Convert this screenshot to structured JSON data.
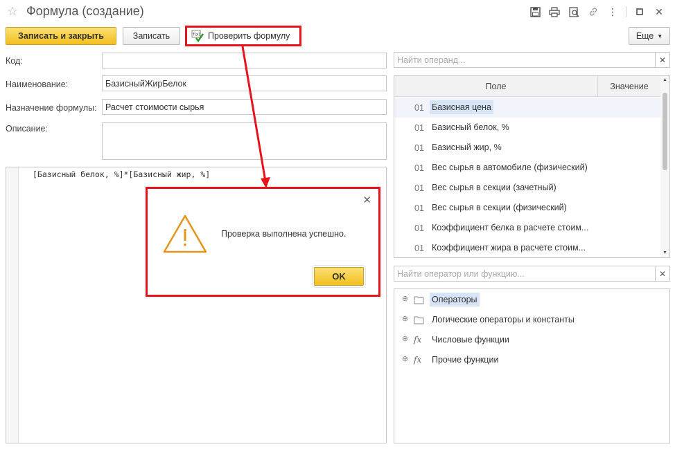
{
  "window": {
    "title": "Формула (создание)"
  },
  "toolbar": {
    "save_close_label": "Записать и закрыть",
    "save_label": "Записать",
    "check_label": "Проверить формулу",
    "more_label": "Еще"
  },
  "form": {
    "code_label": "Код:",
    "code_value": "",
    "name_label": "Наименование:",
    "name_value": "БазисныйЖирБелок",
    "purpose_label": "Назначение формулы:",
    "purpose_value": "Расчет стоимости сырья",
    "description_label": "Описание:",
    "description_value": ""
  },
  "editor": {
    "text": "[Базисный белок, %]*[Базисный жир, %]"
  },
  "operands": {
    "search_placeholder": "Найти операнд...",
    "col_field": "Поле",
    "col_value": "Значение",
    "rows": [
      {
        "num": "01",
        "label": "Базисная цена"
      },
      {
        "num": "01",
        "label": "Базисный белок, %"
      },
      {
        "num": "01",
        "label": "Базисный жир, %"
      },
      {
        "num": "01",
        "label": "Вес сырья в автомобиле (физический)"
      },
      {
        "num": "01",
        "label": "Вес сырья в секции (зачетный)"
      },
      {
        "num": "01",
        "label": "Вес сырья в секции (физический)"
      },
      {
        "num": "01",
        "label": "Коэффициент белка в расчете стоим..."
      },
      {
        "num": "01",
        "label": "Коэффициент жира в расчете стоим..."
      }
    ]
  },
  "operators": {
    "search_placeholder": "Найти оператор или функцию...",
    "items": [
      {
        "label": "Операторы",
        "icon": "folder-icon"
      },
      {
        "label": "Логические операторы и константы",
        "icon": "folder-icon"
      },
      {
        "label": "Числовые функции",
        "icon": "function-icon"
      },
      {
        "label": "Прочие функции",
        "icon": "function-icon"
      }
    ]
  },
  "dialog": {
    "message": "Проверка выполнена успешно.",
    "ok_label": "OK"
  },
  "colors": {
    "accent": "#f1bf1e",
    "highlight": "#e8121b",
    "selection": "#d6e4f6"
  }
}
